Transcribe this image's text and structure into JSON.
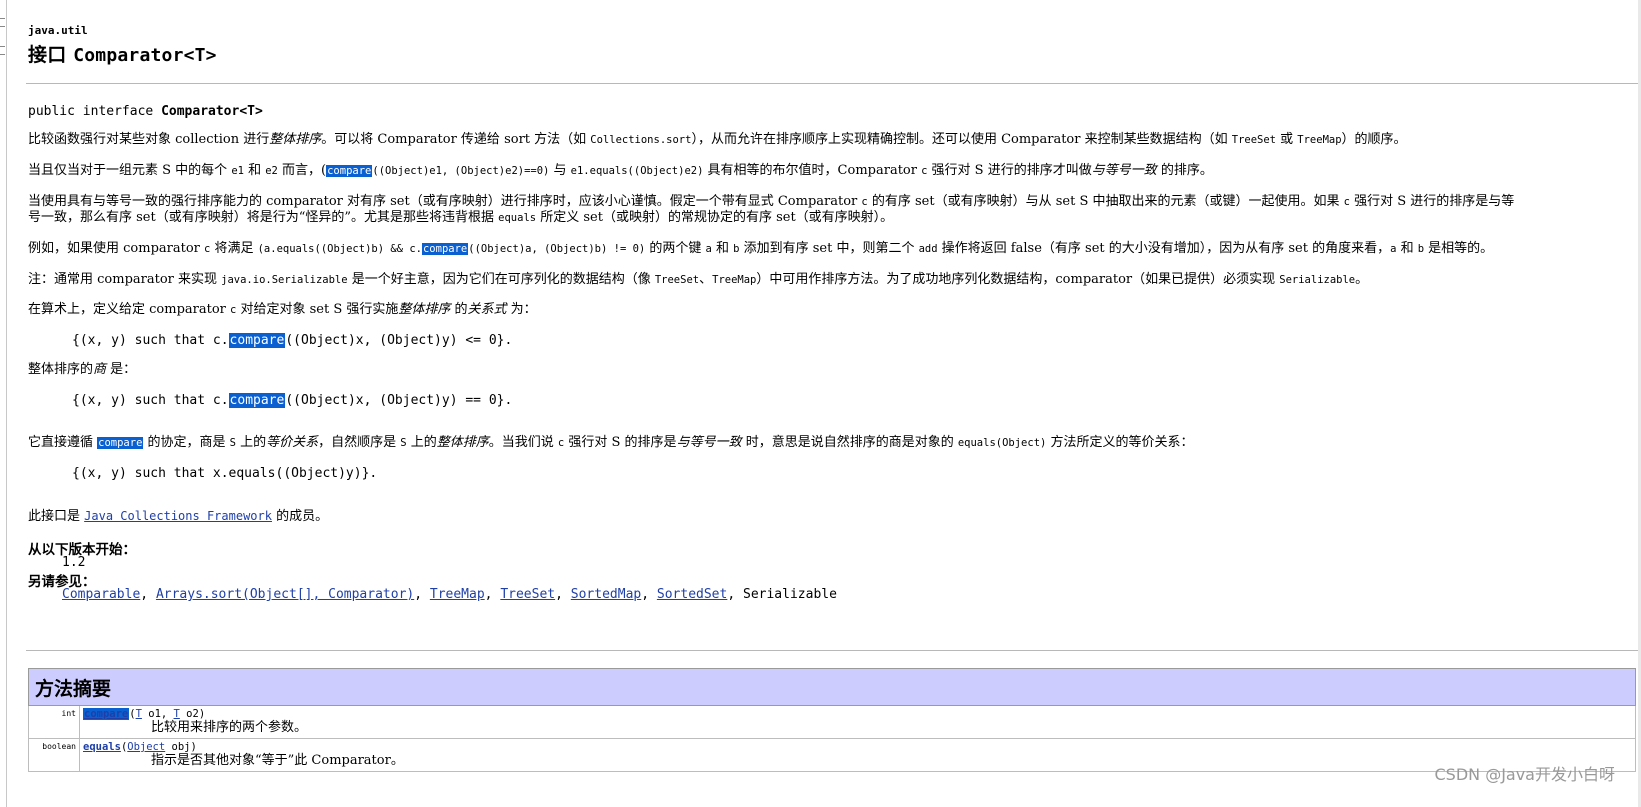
{
  "header": {
    "package": "java.util",
    "title_prefix": "接口",
    "title_name": "Comparator<T>"
  },
  "declaration": {
    "prefix": "public interface ",
    "name": "Comparator<T>"
  },
  "paragraphs": {
    "p1": {
      "a": "比较函数强行对某些对象 collection 进行",
      "b": "整体排序",
      "c": "。可以将 Comparator 传递给 sort 方法（如 ",
      "d": "Collections.sort",
      "e": "），从而允许在排序顺序上实现精确控制。还可以使用 Comparator 来控制某些数据结构（如 ",
      "f": "TreeSet",
      "g": " 或 ",
      "h": "TreeMap",
      "i": "）的顺序。"
    },
    "p2": {
      "a": "当且仅当对于一组元素 S 中的每个 ",
      "b": "e1",
      "c": " 和 ",
      "d": "e2",
      "e": " 而言，(",
      "f": "compare",
      "g": "((Object)e1, (Object)e2)==0)",
      "h": " 与 ",
      "i": "e1.equals((Object)e2)",
      "j": " 具有相等的布尔值时，Comparator ",
      "k": "c",
      "l": " 强行对 S 进行的排序才叫做",
      "m": "与等号一致",
      "n": " 的排序。"
    },
    "p3": {
      "line1a": "当使用具有与等号一致的强行排序能力的 comparator 对有序 set（或有序映射）进行排序时，应该小心谨慎。假定一个带有显式 Comparator ",
      "line1b": "c",
      "line1c": " 的有序 set（或有序映射）与从 set S 中抽取出来的元素（或键）一起使用。如果 ",
      "line1d": "c",
      "line1e": " 强行对 S 进行的排序是与等",
      "line2a": "号一致，那么有序 set（或有序映射）将是行为“怪异的”。尤其是那些将违背根据 ",
      "line2b": "equals",
      "line2c": " 所定义 set（或映射）的常规协定的有序 set（或有序映射）。"
    },
    "p4": {
      "a": "例如，如果使用 comparator ",
      "b": "c",
      "c": " 将满足 ",
      "d": "(a.equals((Object)b) && c.",
      "e": "compare",
      "f": "((Object)a, (Object)b) != 0)",
      "g": " 的两个键 ",
      "h": "a",
      "i": " 和 ",
      "j": "b",
      "k": " 添加到有序 set 中，则第二个 ",
      "l": "add",
      "m": " 操作将返回 false（有序 set 的大小没有增加），因为从有序 set 的角度来看，",
      "n": "a",
      "o": " 和 ",
      "p": "b",
      "q": " 是相等的。"
    },
    "p5": {
      "a": "注：通常用 comparator 来实现 ",
      "b": "java.io.Serializable",
      "c": " 是一个好主意，因为它们在可序列化的数据结构（像 ",
      "d": "TreeSet",
      "e": "、",
      "f": "TreeMap",
      "g": "）中可用作排序方法。为了成功地序列化数据结构，comparator（如果已提供）必须实现 ",
      "h": "Serializable",
      "i": "。"
    },
    "p6": {
      "a": "在算术上，定义给定 comparator ",
      "b": "c",
      "c": " 对给定对象 set S 强行实施",
      "d": "整体排序",
      "e": " 的",
      "f": "关系式",
      "g": " 为："
    },
    "code1": {
      "a": "{(x, y) such that c.",
      "b": "compare",
      "c": "((Object)x, (Object)y) <= 0}."
    },
    "p7": {
      "a": "整体排序的",
      "b": "商",
      "c": " 是："
    },
    "code2": {
      "a": "{(x, y) such that c.",
      "b": "compare",
      "c": "((Object)x, (Object)y) == 0}."
    },
    "p8": {
      "a": "它直接遵循 ",
      "b": "compare",
      "c": " 的协定，商是 ",
      "d": "S",
      "e": " 上的",
      "f": "等价关系",
      "g": "，自然顺序是 ",
      "h": "S",
      "i": " 上的",
      "j": "整体排序",
      "k": "。当我们说 ",
      "l": "c",
      "m": " 强行对 S 的排序是",
      "n": "与等号一致",
      "o": " 时，意思是说自然排序的商是对象的 ",
      "p": "equals(Object)",
      "q": " 方法所定义的等价关系："
    },
    "code3": "{(x, y) such that x.equals((Object)y)}.",
    "p9": {
      "a": "此接口是 ",
      "b": "Java Collections Framework",
      "c": " 的成员。"
    }
  },
  "since": {
    "label": "从以下版本开始：",
    "value": "1.2"
  },
  "see_also": {
    "label": "另请参见：",
    "links": [
      "Comparable",
      "Arrays.sort(Object[], Comparator)",
      "TreeMap",
      "TreeSet",
      "SortedMap",
      "SortedSet"
    ],
    "plain": "Serializable",
    "separator": ", "
  },
  "method_summary": {
    "heading": "方法摘要",
    "rows": [
      {
        "type": "int",
        "name": "compare",
        "params_open": "(",
        "t1": "T",
        "p1": " o1, ",
        "t2": "T",
        "p2": " o2)",
        "description": "比较用来排序的两个参数。"
      },
      {
        "type": "boolean",
        "name": "equals",
        "params_open": "(",
        "t1": "Object",
        "p1": " obj)",
        "description": "指示是否其他对象“等于”此 Comparator。"
      }
    ]
  },
  "watermark": "CSDN @Java开发小白呀"
}
